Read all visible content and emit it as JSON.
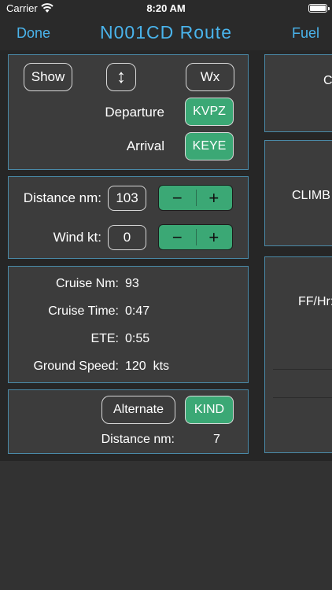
{
  "status": {
    "carrier": "Carrier",
    "time": "8:20 AM"
  },
  "nav": {
    "left": "Done",
    "title": "N001CD  Route",
    "right": "Fuel"
  },
  "route": {
    "show_label": "Show",
    "swap_glyph": "↕",
    "wx_label": "Wx",
    "departure_label": "Departure",
    "departure_value": "KVPZ",
    "arrival_label": "Arrival",
    "arrival_value": "KEYE"
  },
  "distance": {
    "label": "Distance nm:",
    "value": "103",
    "wind_label": "Wind kt:",
    "wind_value": "0",
    "minus": "−",
    "plus": "+"
  },
  "cruise": {
    "nm_label": "Cruise Nm:",
    "nm_value": "93",
    "time_label": "Cruise Time:",
    "time_value": "0:47",
    "ete_label": "ETE:",
    "ete_value": "0:55",
    "gs_label": "Ground Speed:",
    "gs_value": "120  kts"
  },
  "alternate": {
    "button_label": "Alternate",
    "airport": "KIND",
    "distance_label": "Distance nm:",
    "distance_value": "7"
  },
  "right": {
    "top_partial": "Cr",
    "climb_label": "CLIMB",
    "ffhr_label": "FF/Hr:"
  },
  "colors": {
    "accent": "#4ab4ec",
    "green": "#3ba875",
    "panel_border": "#4a8aa8"
  }
}
